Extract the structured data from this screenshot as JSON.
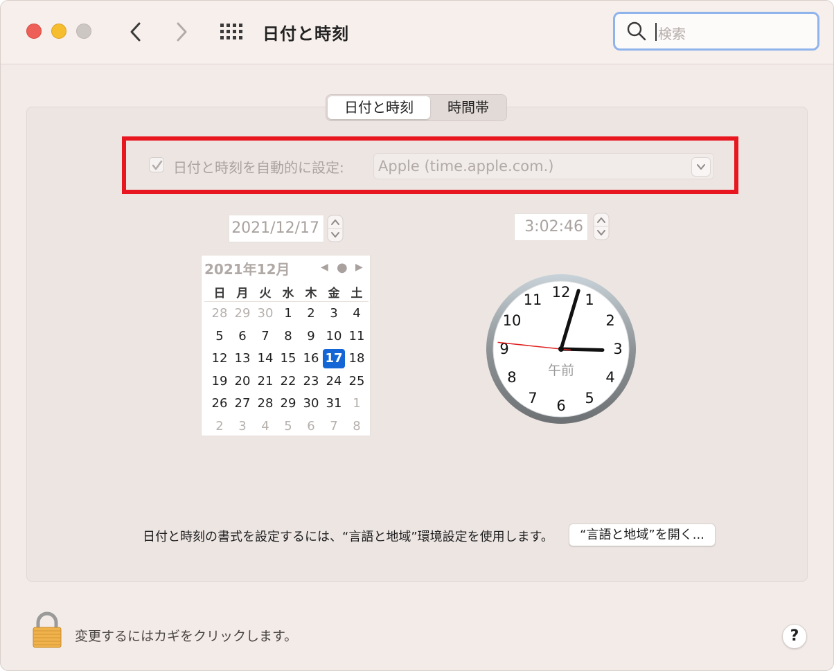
{
  "window": {
    "title": "日付と時刻",
    "search": {
      "placeholder": "検索"
    }
  },
  "tabs": [
    {
      "label": "日付と時刻",
      "selected": true
    },
    {
      "label": "時間帯",
      "selected": false
    }
  ],
  "auto_set": {
    "checked": true,
    "label": "日付と時刻を自動的に設定:",
    "server": "Apple (time.apple.com.)"
  },
  "date_field": {
    "value": "2021/12/17"
  },
  "time_field": {
    "value": "3:02:46"
  },
  "calendar": {
    "header": "2021年12月",
    "weekdays": [
      "日",
      "月",
      "火",
      "水",
      "木",
      "金",
      "土"
    ],
    "weeks": [
      [
        {
          "d": "28",
          "muted": true
        },
        {
          "d": "29",
          "muted": true
        },
        {
          "d": "30",
          "muted": true
        },
        {
          "d": "1"
        },
        {
          "d": "2"
        },
        {
          "d": "3"
        },
        {
          "d": "4"
        }
      ],
      [
        {
          "d": "5"
        },
        {
          "d": "6"
        },
        {
          "d": "7"
        },
        {
          "d": "8"
        },
        {
          "d": "9"
        },
        {
          "d": "10"
        },
        {
          "d": "11"
        }
      ],
      [
        {
          "d": "12"
        },
        {
          "d": "13"
        },
        {
          "d": "14"
        },
        {
          "d": "15"
        },
        {
          "d": "16"
        },
        {
          "d": "17",
          "selected": true
        },
        {
          "d": "18"
        }
      ],
      [
        {
          "d": "19"
        },
        {
          "d": "20"
        },
        {
          "d": "21"
        },
        {
          "d": "22"
        },
        {
          "d": "23"
        },
        {
          "d": "24"
        },
        {
          "d": "25"
        }
      ],
      [
        {
          "d": "26"
        },
        {
          "d": "27"
        },
        {
          "d": "28"
        },
        {
          "d": "29"
        },
        {
          "d": "30"
        },
        {
          "d": "31"
        },
        {
          "d": "1",
          "muted": true
        }
      ],
      [
        {
          "d": "2",
          "muted": true
        },
        {
          "d": "3",
          "muted": true
        },
        {
          "d": "4",
          "muted": true
        },
        {
          "d": "5",
          "muted": true
        },
        {
          "d": "6",
          "muted": true
        },
        {
          "d": "7",
          "muted": true
        },
        {
          "d": "8",
          "muted": true
        }
      ]
    ]
  },
  "clock": {
    "numerals": [
      "12",
      "1",
      "2",
      "3",
      "4",
      "5",
      "6",
      "7",
      "8",
      "9",
      "10",
      "11"
    ],
    "ampm": "午前",
    "hour": 3,
    "minute": 2,
    "second": 46
  },
  "format_note": "日付と時刻の書式を設定するには、“言語と地域”環境設定を使用します。",
  "open_region_button": "“言語と地域”を開く...",
  "lock_text": "変更するにはカギをクリックします。",
  "help_label": "?",
  "colors": {
    "highlight": "#e8161f",
    "selected_day": "#1466d6",
    "second_hand": "#e02020"
  }
}
